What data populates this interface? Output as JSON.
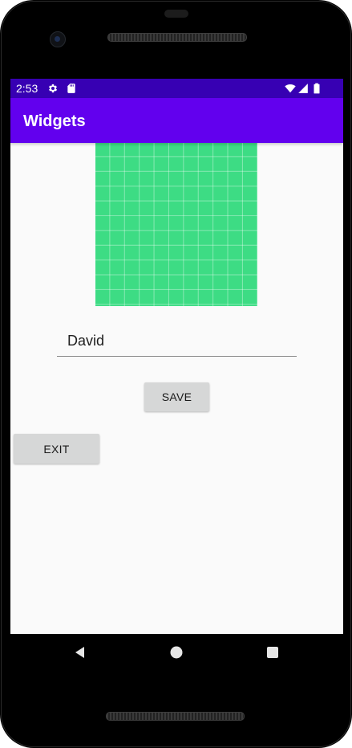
{
  "status_bar": {
    "time": "2:53",
    "icons": [
      "gear-icon",
      "sd-card-icon",
      "wifi-icon",
      "cell-signal-icon",
      "battery-icon"
    ],
    "color": "#3700b3"
  },
  "app_bar": {
    "title": "Widgets",
    "color": "#6200ee"
  },
  "image": {
    "icon": "android-grid-image",
    "color": "#3ddc84"
  },
  "form": {
    "name_value": "David",
    "save_label": "SAVE",
    "exit_label": "EXIT"
  },
  "nav_bar": {
    "buttons": [
      "back-icon",
      "home-icon",
      "recents-icon"
    ]
  }
}
